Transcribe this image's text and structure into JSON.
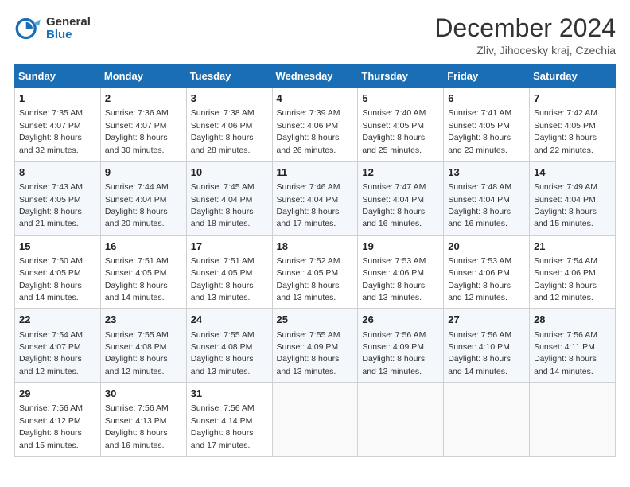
{
  "header": {
    "logo_general": "General",
    "logo_blue": "Blue",
    "title": "December 2024",
    "location": "Zliv, Jihocesky kraj, Czechia"
  },
  "weekdays": [
    "Sunday",
    "Monday",
    "Tuesday",
    "Wednesday",
    "Thursday",
    "Friday",
    "Saturday"
  ],
  "weeks": [
    [
      {
        "day": 1,
        "info": "Sunrise: 7:35 AM\nSunset: 4:07 PM\nDaylight: 8 hours\nand 32 minutes."
      },
      {
        "day": 2,
        "info": "Sunrise: 7:36 AM\nSunset: 4:07 PM\nDaylight: 8 hours\nand 30 minutes."
      },
      {
        "day": 3,
        "info": "Sunrise: 7:38 AM\nSunset: 4:06 PM\nDaylight: 8 hours\nand 28 minutes."
      },
      {
        "day": 4,
        "info": "Sunrise: 7:39 AM\nSunset: 4:06 PM\nDaylight: 8 hours\nand 26 minutes."
      },
      {
        "day": 5,
        "info": "Sunrise: 7:40 AM\nSunset: 4:05 PM\nDaylight: 8 hours\nand 25 minutes."
      },
      {
        "day": 6,
        "info": "Sunrise: 7:41 AM\nSunset: 4:05 PM\nDaylight: 8 hours\nand 23 minutes."
      },
      {
        "day": 7,
        "info": "Sunrise: 7:42 AM\nSunset: 4:05 PM\nDaylight: 8 hours\nand 22 minutes."
      }
    ],
    [
      {
        "day": 8,
        "info": "Sunrise: 7:43 AM\nSunset: 4:05 PM\nDaylight: 8 hours\nand 21 minutes."
      },
      {
        "day": 9,
        "info": "Sunrise: 7:44 AM\nSunset: 4:04 PM\nDaylight: 8 hours\nand 20 minutes."
      },
      {
        "day": 10,
        "info": "Sunrise: 7:45 AM\nSunset: 4:04 PM\nDaylight: 8 hours\nand 18 minutes."
      },
      {
        "day": 11,
        "info": "Sunrise: 7:46 AM\nSunset: 4:04 PM\nDaylight: 8 hours\nand 17 minutes."
      },
      {
        "day": 12,
        "info": "Sunrise: 7:47 AM\nSunset: 4:04 PM\nDaylight: 8 hours\nand 16 minutes."
      },
      {
        "day": 13,
        "info": "Sunrise: 7:48 AM\nSunset: 4:04 PM\nDaylight: 8 hours\nand 16 minutes."
      },
      {
        "day": 14,
        "info": "Sunrise: 7:49 AM\nSunset: 4:04 PM\nDaylight: 8 hours\nand 15 minutes."
      }
    ],
    [
      {
        "day": 15,
        "info": "Sunrise: 7:50 AM\nSunset: 4:05 PM\nDaylight: 8 hours\nand 14 minutes."
      },
      {
        "day": 16,
        "info": "Sunrise: 7:51 AM\nSunset: 4:05 PM\nDaylight: 8 hours\nand 14 minutes."
      },
      {
        "day": 17,
        "info": "Sunrise: 7:51 AM\nSunset: 4:05 PM\nDaylight: 8 hours\nand 13 minutes."
      },
      {
        "day": 18,
        "info": "Sunrise: 7:52 AM\nSunset: 4:05 PM\nDaylight: 8 hours\nand 13 minutes."
      },
      {
        "day": 19,
        "info": "Sunrise: 7:53 AM\nSunset: 4:06 PM\nDaylight: 8 hours\nand 13 minutes."
      },
      {
        "day": 20,
        "info": "Sunrise: 7:53 AM\nSunset: 4:06 PM\nDaylight: 8 hours\nand 12 minutes."
      },
      {
        "day": 21,
        "info": "Sunrise: 7:54 AM\nSunset: 4:06 PM\nDaylight: 8 hours\nand 12 minutes."
      }
    ],
    [
      {
        "day": 22,
        "info": "Sunrise: 7:54 AM\nSunset: 4:07 PM\nDaylight: 8 hours\nand 12 minutes."
      },
      {
        "day": 23,
        "info": "Sunrise: 7:55 AM\nSunset: 4:08 PM\nDaylight: 8 hours\nand 12 minutes."
      },
      {
        "day": 24,
        "info": "Sunrise: 7:55 AM\nSunset: 4:08 PM\nDaylight: 8 hours\nand 13 minutes."
      },
      {
        "day": 25,
        "info": "Sunrise: 7:55 AM\nSunset: 4:09 PM\nDaylight: 8 hours\nand 13 minutes."
      },
      {
        "day": 26,
        "info": "Sunrise: 7:56 AM\nSunset: 4:09 PM\nDaylight: 8 hours\nand 13 minutes."
      },
      {
        "day": 27,
        "info": "Sunrise: 7:56 AM\nSunset: 4:10 PM\nDaylight: 8 hours\nand 14 minutes."
      },
      {
        "day": 28,
        "info": "Sunrise: 7:56 AM\nSunset: 4:11 PM\nDaylight: 8 hours\nand 14 minutes."
      }
    ],
    [
      {
        "day": 29,
        "info": "Sunrise: 7:56 AM\nSunset: 4:12 PM\nDaylight: 8 hours\nand 15 minutes."
      },
      {
        "day": 30,
        "info": "Sunrise: 7:56 AM\nSunset: 4:13 PM\nDaylight: 8 hours\nand 16 minutes."
      },
      {
        "day": 31,
        "info": "Sunrise: 7:56 AM\nSunset: 4:14 PM\nDaylight: 8 hours\nand 17 minutes."
      },
      null,
      null,
      null,
      null
    ]
  ]
}
